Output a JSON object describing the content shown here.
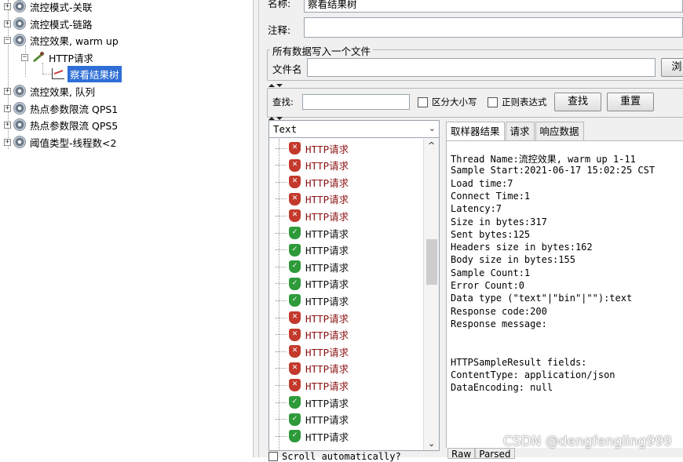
{
  "tree": {
    "nodes": [
      {
        "label": "流控模式-关联"
      },
      {
        "label": "流控模式-链路"
      },
      {
        "label": "流控效果, warm up"
      },
      {
        "label": "HTTP请求"
      },
      {
        "label": "察看结果树"
      },
      {
        "label": "流控效果, 队列"
      },
      {
        "label": "热点参数限流 QPS1"
      },
      {
        "label": "热点参数限流 QPS5"
      },
      {
        "label": "阈值类型-线程数<2"
      }
    ]
  },
  "form": {
    "name_label": "名称:",
    "name_value": "察看结果树",
    "comment_label": "注释:",
    "comment_value": "",
    "file_group_title": "所有数据写入一个文件",
    "filename_label": "文件名",
    "filename_value": "",
    "browse_label": "浏"
  },
  "search": {
    "label": "查找:",
    "value": "",
    "case_label": "区分大小写",
    "regex_label": "正则表达式",
    "find_button": "查找",
    "reset_button": "重置"
  },
  "renderer": {
    "selected": "Text"
  },
  "results": [
    {
      "label": "HTTP请求",
      "status": "fail"
    },
    {
      "label": "HTTP请求",
      "status": "fail"
    },
    {
      "label": "HTTP请求",
      "status": "fail"
    },
    {
      "label": "HTTP请求",
      "status": "fail"
    },
    {
      "label": "HTTP请求",
      "status": "fail"
    },
    {
      "label": "HTTP请求",
      "status": "ok"
    },
    {
      "label": "HTTP请求",
      "status": "ok"
    },
    {
      "label": "HTTP请求",
      "status": "ok"
    },
    {
      "label": "HTTP请求",
      "status": "ok"
    },
    {
      "label": "HTTP请求",
      "status": "ok"
    },
    {
      "label": "HTTP请求",
      "status": "fail"
    },
    {
      "label": "HTTP请求",
      "status": "fail"
    },
    {
      "label": "HTTP请求",
      "status": "fail"
    },
    {
      "label": "HTTP请求",
      "status": "fail"
    },
    {
      "label": "HTTP请求",
      "status": "fail"
    },
    {
      "label": "HTTP请求",
      "status": "ok"
    },
    {
      "label": "HTTP请求",
      "status": "ok"
    },
    {
      "label": "HTTP请求",
      "status": "ok"
    }
  ],
  "tabs": [
    "取样器结果",
    "请求",
    "响应数据"
  ],
  "details": [
    "Thread Name:流控效果, warm up 1-11",
    "Sample Start:2021-06-17 15:02:25 CST",
    "Load time:7",
    "Connect Time:1",
    "Latency:7",
    "Size in bytes:317",
    "Sent bytes:125",
    "Headers size in bytes:162",
    "Body size in bytes:155",
    "Sample Count:1",
    "Error Count:0",
    "Data type (\"text\"|\"bin\"|\"\"):text",
    "Response code:200",
    "Response message:",
    "",
    "",
    "HTTPSampleResult fields:",
    "ContentType: application/json",
    "DataEncoding: null"
  ],
  "bottom_tabs": [
    "Raw",
    "Parsed"
  ],
  "scroll_auto_label": "Scroll automatically?",
  "watermark": "CSDN @dengfengling999",
  "colors": {
    "fail": "#c33a2c",
    "ok": "#2e9a3a",
    "selection": "#2f6fd6"
  }
}
